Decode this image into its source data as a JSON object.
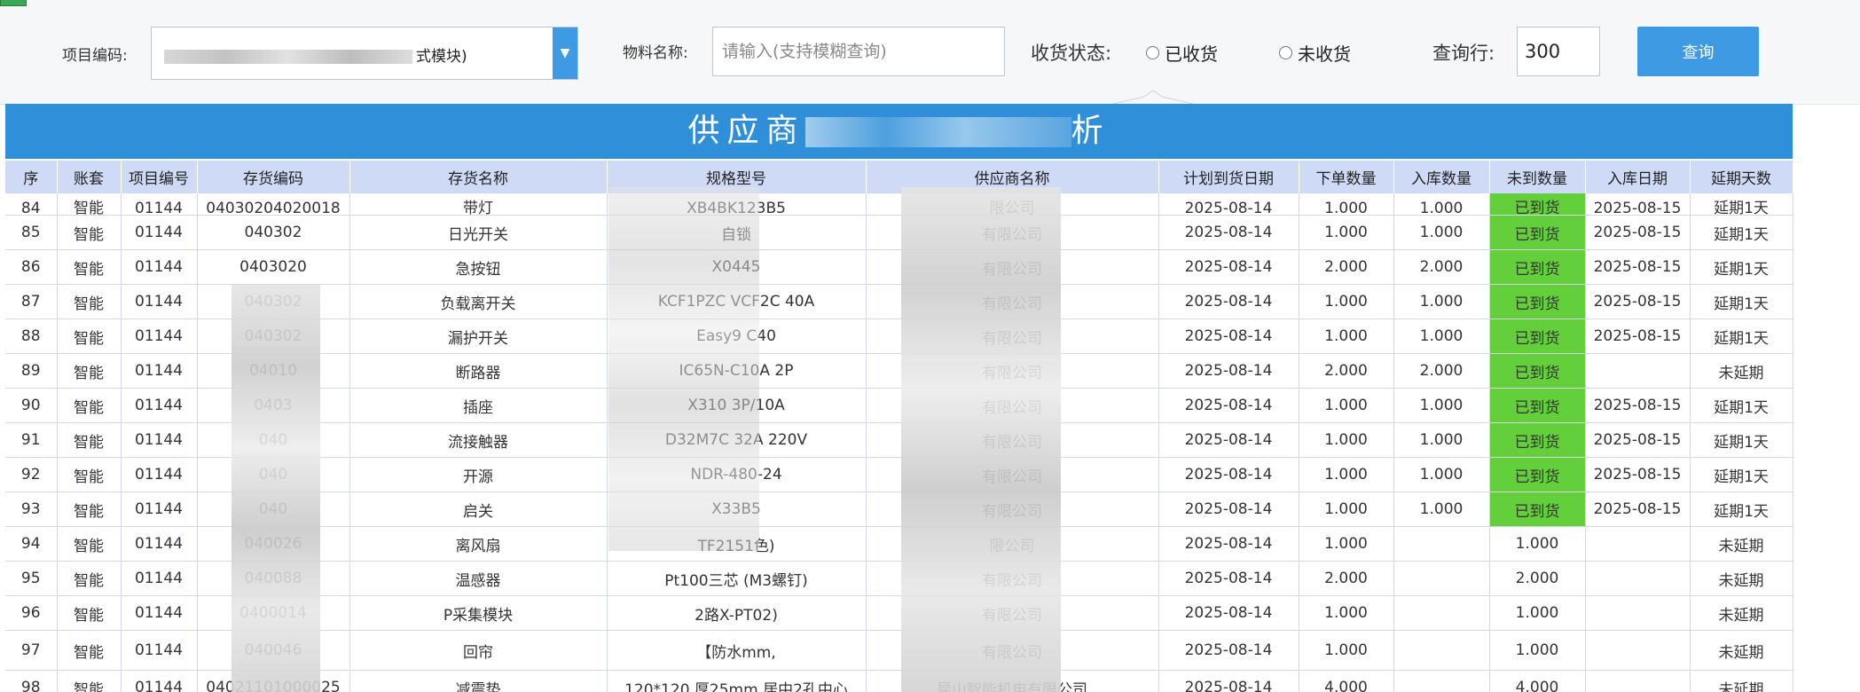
{
  "filters": {
    "project_label": "项目编码:",
    "project_value": "式模块)",
    "material_label": "物料名称:",
    "material_placeholder": "请输入(支持模糊查询)",
    "status_label": "收货状态:",
    "status_options": [
      "已收货",
      "未收货"
    ],
    "rows_label": "查询行:",
    "rows_value": "300",
    "query_button": "查询"
  },
  "report": {
    "title_left": "供应商",
    "title_right": "析"
  },
  "table": {
    "columns": [
      "序",
      "账套",
      "项目编号",
      "存货编码",
      "存货名称",
      "规格型号",
      "供应商名称",
      "计划到货日期",
      "下单数量",
      "入库数量",
      "未到数量",
      "入库日期",
      "延期天数"
    ],
    "rows": [
      {
        "seq": "84",
        "book": "智能",
        "proj": "01144",
        "code": "04030204020018",
        "name": "带灯",
        "spec": "XB4BK123B5",
        "supplier": "限公司",
        "plan": "2025-08-14",
        "ordered": "1.000",
        "stocked": "1.000",
        "pending": "已到货",
        "pending_status": "arrived",
        "indate": "2025-08-15",
        "delay": "延期1天",
        "delay_status": "late"
      },
      {
        "seq": "85",
        "book": "智能",
        "proj": "01144",
        "code": "040302",
        "name": "日光开关",
        "spec": "自锁",
        "supplier": "有限公司",
        "plan": "2025-08-14",
        "ordered": "1.000",
        "stocked": "1.000",
        "pending": "已到货",
        "pending_status": "arrived",
        "indate": "2025-08-15",
        "delay": "延期1天",
        "delay_status": "late"
      },
      {
        "seq": "86",
        "book": "智能",
        "proj": "01144",
        "code": "0403020",
        "name": "急按钮",
        "spec": "X0445",
        "supplier": "有限公司",
        "plan": "2025-08-14",
        "ordered": "2.000",
        "stocked": "2.000",
        "pending": "已到货",
        "pending_status": "arrived",
        "indate": "2025-08-15",
        "delay": "延期1天",
        "delay_status": "late"
      },
      {
        "seq": "87",
        "book": "智能",
        "proj": "01144",
        "code": "040302",
        "name": "负载离开关",
        "spec": "KCF1PZC VCF2C 40A",
        "supplier": "有限公司",
        "plan": "2025-08-14",
        "ordered": "1.000",
        "stocked": "1.000",
        "pending": "已到货",
        "pending_status": "arrived",
        "indate": "2025-08-15",
        "delay": "延期1天",
        "delay_status": "late"
      },
      {
        "seq": "88",
        "book": "智能",
        "proj": "01144",
        "code": "040302",
        "name": "漏护开关",
        "spec": "Easy9 C40",
        "supplier": "有限公司",
        "plan": "2025-08-14",
        "ordered": "1.000",
        "stocked": "1.000",
        "pending": "已到货",
        "pending_status": "arrived",
        "indate": "2025-08-15",
        "delay": "延期1天",
        "delay_status": "late"
      },
      {
        "seq": "89",
        "book": "智能",
        "proj": "01144",
        "code": "04010",
        "name": "断路器",
        "spec": "IC65N-C10A 2P",
        "supplier": "有限公司",
        "plan": "2025-08-14",
        "ordered": "2.000",
        "stocked": "2.000",
        "pending": "已到货",
        "pending_status": "arrived",
        "indate": "",
        "delay": "未延期",
        "delay_status": "ontime"
      },
      {
        "seq": "90",
        "book": "智能",
        "proj": "01144",
        "code": "0403",
        "name": "插座",
        "spec": "X310 3P/10A",
        "supplier": "有限公司",
        "plan": "2025-08-14",
        "ordered": "1.000",
        "stocked": "1.000",
        "pending": "已到货",
        "pending_status": "arrived",
        "indate": "2025-08-15",
        "delay": "延期1天",
        "delay_status": "late"
      },
      {
        "seq": "91",
        "book": "智能",
        "proj": "01144",
        "code": "040",
        "name": "流接触器",
        "spec": "D32M7C 32A 220V",
        "supplier": "有限公司",
        "plan": "2025-08-14",
        "ordered": "1.000",
        "stocked": "1.000",
        "pending": "已到货",
        "pending_status": "arrived",
        "indate": "2025-08-15",
        "delay": "延期1天",
        "delay_status": "late"
      },
      {
        "seq": "92",
        "book": "智能",
        "proj": "01144",
        "code": "040",
        "name": "开源",
        "spec": "NDR-480-24",
        "supplier": "有限公司",
        "plan": "2025-08-14",
        "ordered": "1.000",
        "stocked": "1.000",
        "pending": "已到货",
        "pending_status": "arrived",
        "indate": "2025-08-15",
        "delay": "延期1天",
        "delay_status": "late"
      },
      {
        "seq": "93",
        "book": "智能",
        "proj": "01144",
        "code": "040",
        "name": "启关",
        "spec": "X33B5",
        "supplier": "有限公司",
        "plan": "2025-08-14",
        "ordered": "1.000",
        "stocked": "1.000",
        "pending": "已到货",
        "pending_status": "arrived",
        "indate": "2025-08-15",
        "delay": "延期1天",
        "delay_status": "late"
      },
      {
        "seq": "94",
        "book": "智能",
        "proj": "01144",
        "code": "040026",
        "name": "离风扇",
        "spec": "TF2151色)",
        "supplier": "限公司",
        "plan": "2025-08-14",
        "ordered": "1.000",
        "stocked": "",
        "pending": "1.000",
        "pending_status": "open",
        "indate": "",
        "delay": "未延期",
        "delay_status": "ontime"
      },
      {
        "seq": "95",
        "book": "智能",
        "proj": "01144",
        "code": "040088",
        "name": "温感器",
        "spec": "Pt100三芯 (M3螺钉)",
        "supplier": "有限公司",
        "plan": "2025-08-14",
        "ordered": "2.000",
        "stocked": "",
        "pending": "2.000",
        "pending_status": "open",
        "indate": "",
        "delay": "未延期",
        "delay_status": "ontime"
      },
      {
        "seq": "96",
        "book": "智能",
        "proj": "01144",
        "code": "0400014",
        "name": "P采集模块",
        "spec": "2路X-PT02)",
        "supplier": "有限公司",
        "plan": "2025-08-14",
        "ordered": "1.000",
        "stocked": "",
        "pending": "1.000",
        "pending_status": "open",
        "indate": "",
        "delay": "未延期",
        "delay_status": "ontime"
      },
      {
        "seq": "97",
        "book": "智能",
        "proj": "01144",
        "code": "040046",
        "name": "回帘",
        "spec": "【防水mm,",
        "supplier": "有限公司",
        "plan": "2025-08-14",
        "ordered": "1.000",
        "stocked": "",
        "pending": "1.000",
        "pending_status": "open",
        "indate": "",
        "delay": "未延期",
        "delay_status": "ontime"
      },
      {
        "seq": "98",
        "book": "智能",
        "proj": "01144",
        "code": "04021101000025",
        "name": "减震垫",
        "spec": "120*120 厚25mm,居中2孔中心",
        "supplier": "昆山智能机电有限公司",
        "plan": "2025-08-14",
        "ordered": "4.000",
        "stocked": "",
        "pending": "4.000",
        "pending_status": "open",
        "indate": "",
        "delay": "未延期",
        "delay_status": "ontime"
      }
    ]
  },
  "colors": {
    "accent": "#3d9ae3",
    "header_bg": "#cfdaf7",
    "arrived_bg": "#63cf3a",
    "late_text": "#f24d3a",
    "ontime_text": "#2b9a4a"
  }
}
